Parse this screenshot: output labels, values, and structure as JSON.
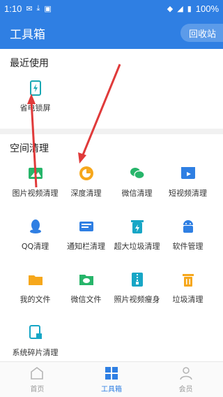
{
  "status": {
    "time": "1:10",
    "battery": "100%"
  },
  "header": {
    "title": "工具箱",
    "recycle_label": "回收站"
  },
  "sections": [
    {
      "title": "最近使用",
      "tools": [
        {
          "label": "省电锁屏",
          "icon": "power-saving-icon",
          "color": "#19a8b3"
        }
      ]
    },
    {
      "title": "空间清理",
      "tools": [
        {
          "label": "图片视频清理",
          "icon": "picture-icon",
          "color": "#27b56a"
        },
        {
          "label": "深度清理",
          "icon": "deep-clean-icon",
          "color": "#f6a71b"
        },
        {
          "label": "微信清理",
          "icon": "wechat-icon",
          "color": "#27b56a"
        },
        {
          "label": "短视频清理",
          "icon": "short-video-icon",
          "color": "#2f7fe3"
        },
        {
          "label": "QQ清理",
          "icon": "qq-icon",
          "color": "#2f7fe3"
        },
        {
          "label": "通知栏清理",
          "icon": "notification-icon",
          "color": "#2f7fe3"
        },
        {
          "label": "超大垃圾清理",
          "icon": "large-junk-icon",
          "color": "#17a6c6"
        },
        {
          "label": "软件管理",
          "icon": "android-icon",
          "color": "#2f7fe3"
        },
        {
          "label": "我的文件",
          "icon": "folder-icon",
          "color": "#f6a71b"
        },
        {
          "label": "微信文件",
          "icon": "wechat-file-icon",
          "color": "#27b56a"
        },
        {
          "label": "照片视频瘦身",
          "icon": "zip-icon",
          "color": "#17a6c6"
        },
        {
          "label": "垃圾清理",
          "icon": "trash-icon",
          "color": "#f6a71b"
        },
        {
          "label": "系统碎片清理",
          "icon": "system-fragment-icon",
          "color": "#17a6c6"
        }
      ]
    }
  ],
  "bottom_nav": [
    {
      "label": "首页",
      "icon": "home-icon",
      "active": false
    },
    {
      "label": "工具箱",
      "icon": "toolbox-grid-icon",
      "active": true
    },
    {
      "label": "会员",
      "icon": "member-icon",
      "active": false
    }
  ]
}
